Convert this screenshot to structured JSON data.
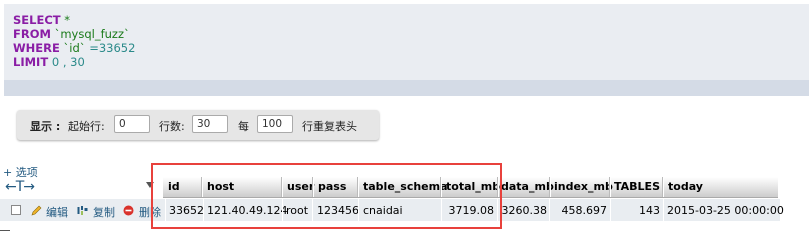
{
  "sql": {
    "select_kw": "SELECT",
    "select_rest": " *",
    "from_kw": "FROM",
    "from_table": " `mysql_fuzz`",
    "where_kw": "WHERE",
    "where_col": " `id`",
    "where_op": " =",
    "where_val": "33652",
    "limit_kw": "LIMIT",
    "limit_val": " 0 , 30"
  },
  "controls": {
    "display_label": "显示 :",
    "start_row_label": "起始行:",
    "start_row_value": "0",
    "row_count_label": "行数:",
    "row_count_value": "30",
    "per_label": "每",
    "repeat_value": "100",
    "repeat_label": "行重复表头"
  },
  "options_link": "+ 选项",
  "arrows": "←T→",
  "table": {
    "columns": [
      "id",
      "host",
      "user",
      "pass",
      "table_schema",
      "total_mb",
      "data_mb",
      "index_mb",
      "TABLES",
      "today"
    ],
    "row": {
      "edit_label": "编辑",
      "copy_label": "复制",
      "delete_label": "删除",
      "id": "33652",
      "host": "121.40.49.124",
      "user": "root",
      "pass": "123456",
      "table_schema": "cnaidai",
      "total_mb": "3719.08",
      "data_mb": "3260.38",
      "index_mb": "458.697",
      "TABLES": "143",
      "today": "2015-03-25 00:00:00"
    }
  },
  "colors": {
    "keyword": "#8a1da5",
    "highlight_box": "#e8413c",
    "link": "#235a81"
  }
}
